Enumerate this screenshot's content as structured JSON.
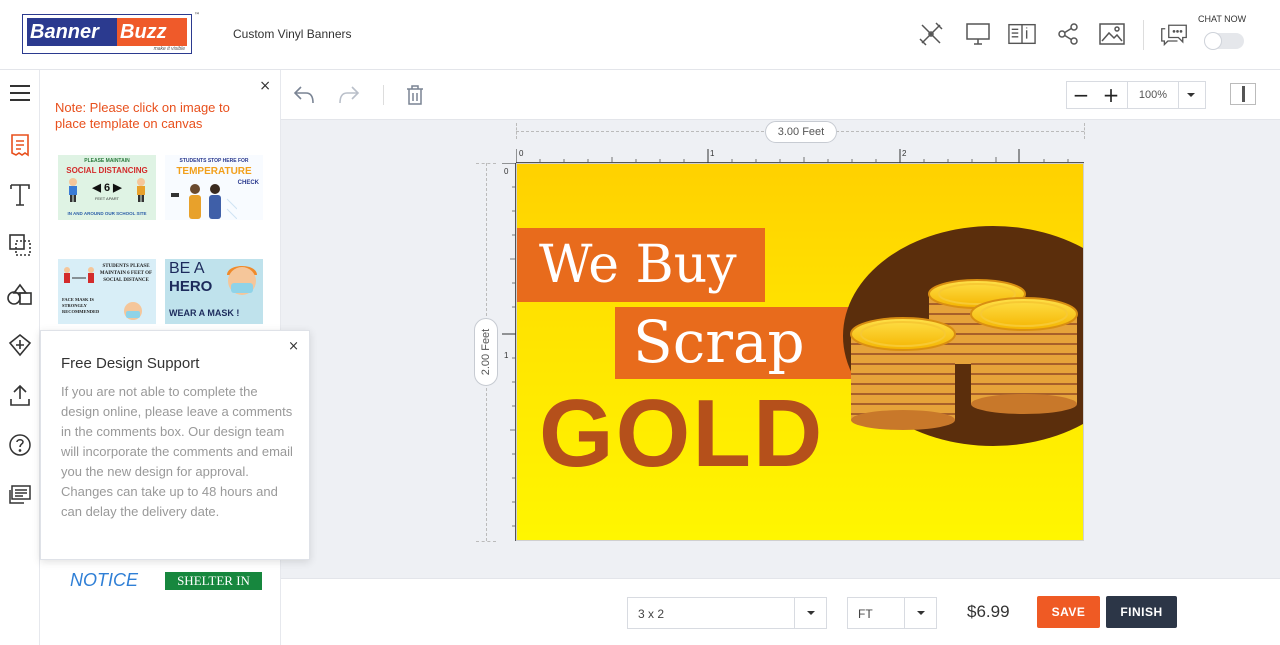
{
  "header": {
    "logo": {
      "part1": "Banner",
      "part2": "Buzz",
      "tagline": "make it visible",
      "tm": "™"
    },
    "product_name": "Custom Vinyl Banners",
    "icons": [
      "design-tools-icon",
      "preview-monitor-icon",
      "instructions-book-icon",
      "share-icon",
      "image-icon"
    ],
    "chat_label": "CHAT NOW",
    "chat_toggle_on": false
  },
  "rail": {
    "icons": [
      "menu-icon",
      "templates-icon",
      "text-icon",
      "layers-icon",
      "shapes-icon",
      "clipart-icon",
      "upload-icon",
      "help-icon",
      "comments-icon"
    ],
    "active": "templates-icon"
  },
  "panel": {
    "close": "×",
    "note": "Note: Please click on image to place template on canvas",
    "templates": [
      {
        "lines": [
          "PLEASE MAINTAIN",
          "SOCIAL DISTANCING",
          "◀ 6 ▶",
          "FEET APART",
          "IN AND AROUND OUR SCHOOL SITE"
        ]
      },
      {
        "lines": [
          "STUDENTS STOP HERE FOR",
          "TEMPERATURE",
          "CHECK"
        ]
      },
      {
        "lines": [
          "STUDENTS PLEASE MAINTAIN 6 FEET OF SOCIAL DISTANCE",
          "FACE MASK IS STRONGLY RECOMMENDED"
        ]
      },
      {
        "lines": [
          "BE A",
          "HERO",
          "WEAR A MASK !"
        ]
      },
      {
        "lines": [
          "NOTICE"
        ]
      },
      {
        "lines": [
          "SHELTER IN PLACE"
        ]
      }
    ]
  },
  "popup": {
    "close": "×",
    "title": "Free Design Support",
    "body": "If you are not able to complete the design online, please leave a comments in the comments box. Our design team will incorporate the comments and email you the new design for approval. Changes can take up to 48 hours and can delay the delivery date."
  },
  "toolbar": {
    "icons": [
      "undo-icon",
      "redo-icon",
      "delete-icon"
    ],
    "zoom_minus": "−",
    "zoom_plus": "+",
    "zoom_value": "100%"
  },
  "canvas": {
    "width_label": "3.00 Feet",
    "height_label": "2.00 Feet",
    "ruler_top": [
      "0",
      "1",
      "2"
    ],
    "ruler_left": [
      "0",
      "1"
    ],
    "design": {
      "line1": "We Buy",
      "line2": "Scrap",
      "line3": "GOLD",
      "colors": {
        "background_top": "#ffd100",
        "background_bottom": "#fff600",
        "orange": "#e86b1c",
        "gold_text": "#b5501b",
        "oval": "#5b2e0c"
      }
    }
  },
  "bottom": {
    "size_value": "3 x 2",
    "unit_value": "FT",
    "price": "$6.99",
    "save_label": "SAVE",
    "finish_label": "FINISH",
    "colors": {
      "save": "#ef5a24",
      "finish": "#2c3647"
    }
  }
}
